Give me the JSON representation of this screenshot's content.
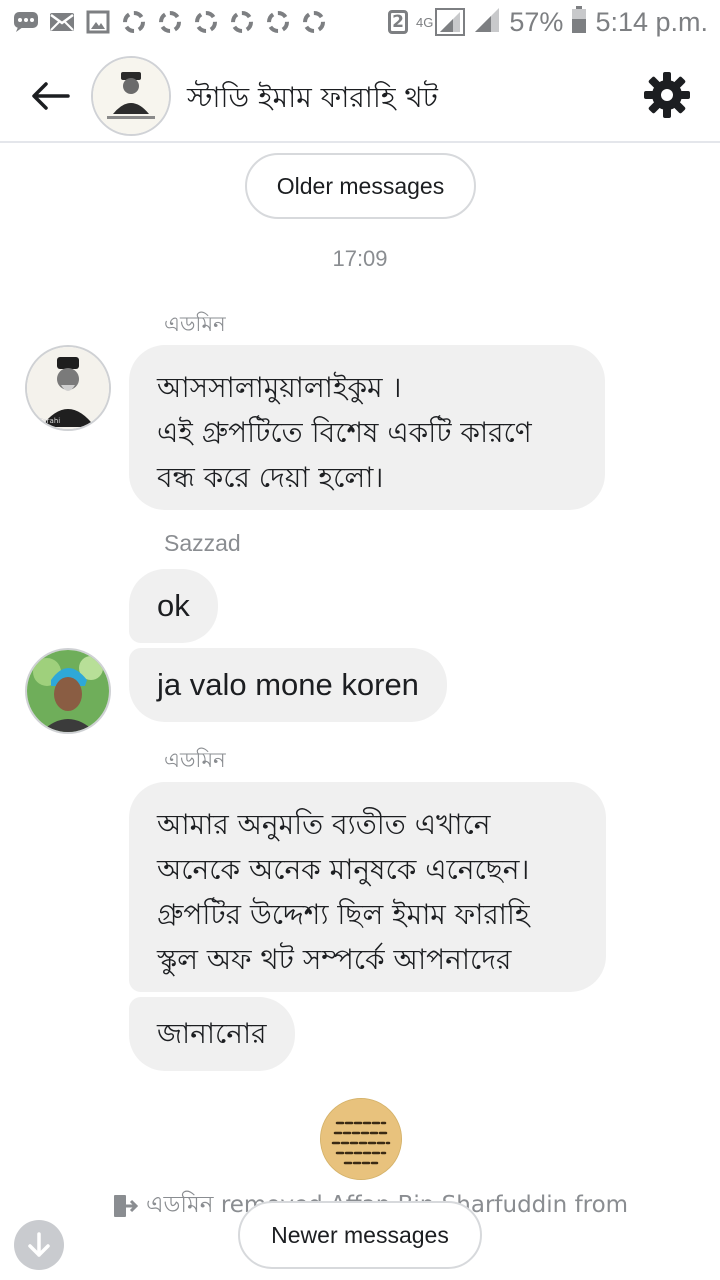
{
  "status_bar": {
    "sim_badge": "2",
    "network": "4G",
    "battery": "57%",
    "time": "5:14 p.m."
  },
  "header": {
    "title": "স্টাডি ইমাম ফারাহি থট"
  },
  "pagination": {
    "older": "Older messages",
    "newer": "Newer messages"
  },
  "timestamp": "17:09",
  "messages": [
    {
      "sender": "এডমিন",
      "lines": [
        "আসসালামুয়ালাইকুম ।",
        "এই গ্রুপটিতে বিশেষ একটি কারণে",
        "বন্ধ করে দেয়া হলো।"
      ]
    },
    {
      "sender": "Sazzad",
      "bubbles": [
        "ok",
        "ja valo mone koren"
      ]
    },
    {
      "sender": "এডমিন",
      "lines": [
        "আমার অনুমতি ব্যতীত এখানে",
        "অনেকে অনেক মানুষকে এনেছেন।",
        "গ্রুপটির উদ্দেশ্য ছিল ইমাম ফারাহি",
        "স্কুল অফ থট সম্পর্কে আপনাদের"
      ],
      "extra": "জানানোর"
    }
  ],
  "system": {
    "text": "এডমিন removed Affan Bin Sharfuddin from"
  }
}
